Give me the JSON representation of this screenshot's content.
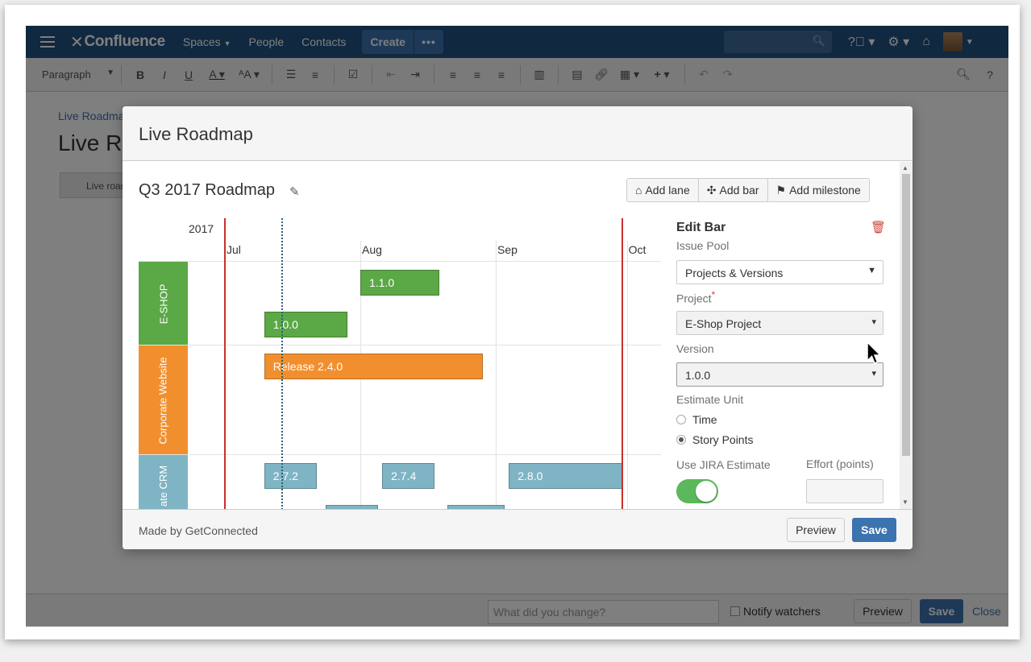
{
  "nav": {
    "brand": "Confluence",
    "spaces": "Spaces",
    "people": "People",
    "contacts": "Contacts",
    "create": "Create",
    "more": "•••"
  },
  "toolbar": {
    "paragraph": "Paragraph"
  },
  "page": {
    "breadcrumb": "Live Roadma",
    "title": "Live R",
    "chip": "Live road"
  },
  "savebar": {
    "change_placeholder": "What did you change?",
    "notify": "Notify watchers",
    "preview": "Preview",
    "save": "Save",
    "close": "Close"
  },
  "dialog": {
    "title": "Live Roadmap",
    "roadmap_title": "Q3 2017 Roadmap",
    "add_lane": "Add lane",
    "add_bar": "Add bar",
    "add_milestone": "Add milestone",
    "made_by": "Made by GetConnected",
    "preview": "Preview",
    "save": "Save"
  },
  "chart_data": {
    "type": "gantt",
    "year": "2017",
    "months": [
      "Jul",
      "Aug",
      "Sep",
      "Oct"
    ],
    "lanes": [
      {
        "name": "E-SHOP",
        "color": "#5ba846"
      },
      {
        "name": "Corporate Website",
        "color": "#f18f2e"
      },
      {
        "name": "ate CRM",
        "color": "#7fb4c4"
      }
    ],
    "bars": [
      {
        "label": "1.1.0",
        "lane": "E-SHOP",
        "start": "2017-08-01",
        "end": "2017-08-19",
        "color": "#5ba846"
      },
      {
        "label": "1.0.0",
        "lane": "E-SHOP",
        "start": "2017-07-10",
        "end": "2017-07-29",
        "color": "#5ba846"
      },
      {
        "label": "Release 2.4.0",
        "lane": "Corporate Website",
        "start": "2017-07-10",
        "end": "2017-08-29",
        "color": "#f18f2e"
      },
      {
        "label": "2.7.2",
        "lane": "ate CRM",
        "start": "2017-07-10",
        "end": "2017-07-22",
        "color": "#7fb4c4"
      },
      {
        "label": "2.7.4",
        "lane": "ate CRM",
        "start": "2017-08-06",
        "end": "2017-08-18",
        "color": "#7fb4c4"
      },
      {
        "label": "2.8.0",
        "lane": "ate CRM",
        "start": "2017-09-04",
        "end": "2017-09-30",
        "color": "#7fb4c4"
      },
      {
        "label": "",
        "lane": "ate CRM",
        "start": "2017-07-24",
        "end": "2017-08-05",
        "color": "#7fb4c4"
      },
      {
        "label": "",
        "lane": "ate CRM",
        "start": "2017-08-21",
        "end": "2017-09-03",
        "color": "#7fb4c4"
      }
    ],
    "markers": [
      {
        "kind": "boundary",
        "date": "2017-07-01",
        "color": "#c9302c"
      },
      {
        "kind": "boundary",
        "date": "2017-09-30",
        "color": "#c9302c"
      },
      {
        "kind": "today",
        "date": "2017-07-14",
        "color": "#2a5f7a"
      }
    ]
  },
  "edit_bar": {
    "title": "Edit Bar",
    "issue_pool_label": "Issue Pool",
    "issue_pool_value": "Projects & Versions",
    "project_label": "Project",
    "project_required": "*",
    "project_value": "E-Shop Project",
    "version_label": "Version",
    "version_value": "1.0.0",
    "estimate_unit_label": "Estimate Unit",
    "unit_time": "Time",
    "unit_story_points": "Story Points",
    "selected_unit": "Story Points",
    "use_jira_label": "Use JIRA Estimate",
    "use_jira_on": true,
    "effort_label": "Effort (points)",
    "effort_value": ""
  },
  "colors": {
    "nav_bg": "#205081",
    "primary_button": "#3b73af",
    "toggle_on": "#5cb85c",
    "danger": "#d04437"
  }
}
